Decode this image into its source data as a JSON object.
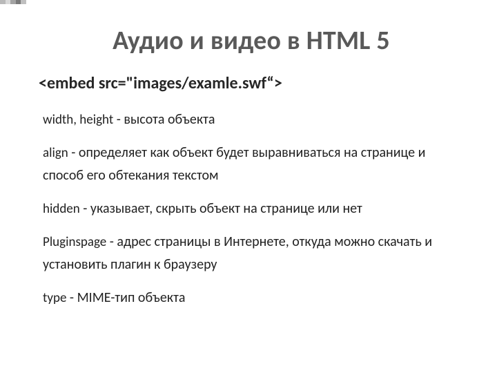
{
  "title": "Аудио и видео в HTML 5",
  "code": "<embed src=\"images/examle.swf“>",
  "attrs": [
    {
      "name": "width, height",
      "desc": " - высота объекта"
    },
    {
      "name": "align",
      "desc": " - определяет как объект будет выравниваться на странице и способ его обтекания текстом"
    },
    {
      "name": "hidden",
      "desc": " - указывает, скрыть объект на странице или нет"
    },
    {
      "name": "Pluginspage",
      "desc": " - адрес страницы в Интернете, откуда можно скачать и установить плагин к браузеру"
    },
    {
      "name": "type",
      "desc": " - MIME-тип объекта"
    }
  ]
}
